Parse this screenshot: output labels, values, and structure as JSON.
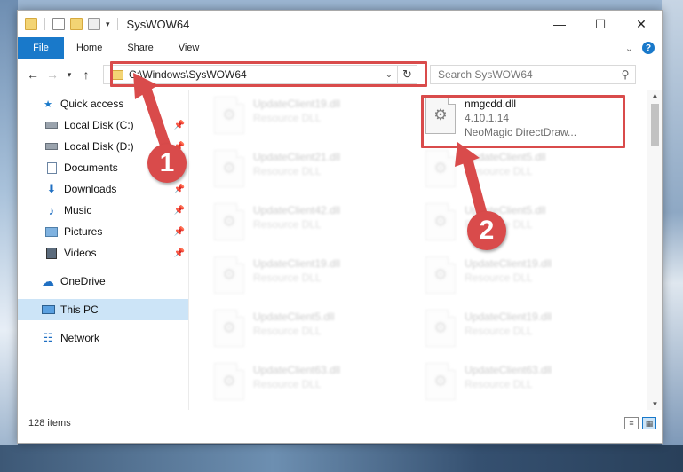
{
  "window": {
    "title": "SysWOW64"
  },
  "ribbon": {
    "tabs": [
      "File",
      "Home",
      "Share",
      "View"
    ]
  },
  "address": {
    "path": "C:\\Windows\\SysWOW64"
  },
  "search": {
    "placeholder": "Search SysWOW64"
  },
  "sidebar": {
    "quick_access": "Quick access",
    "items": [
      {
        "label": "Local Disk (C:)",
        "icon": "drive-icon",
        "pinned": true
      },
      {
        "label": "Local Disk (D:)",
        "icon": "drive-icon",
        "pinned": true
      },
      {
        "label": "Documents",
        "icon": "documents-icon",
        "pinned": true
      },
      {
        "label": "Downloads",
        "icon": "downloads-icon",
        "pinned": true
      },
      {
        "label": "Music",
        "icon": "music-icon",
        "pinned": true
      },
      {
        "label": "Pictures",
        "icon": "pictures-icon",
        "pinned": true
      },
      {
        "label": "Videos",
        "icon": "videos-icon",
        "pinned": true
      }
    ],
    "onedrive": "OneDrive",
    "this_pc": "This PC",
    "network": "Network"
  },
  "files": [
    {
      "name": "UpdateClient19.dll",
      "line1": "Resource DLL",
      "line2": ""
    },
    {
      "name": "nmgcdd.dll",
      "line1": "4.10.1.14",
      "line2": "NeoMagic DirectDraw..."
    },
    {
      "name": "UpdateClient21.dll",
      "line1": "Resource DLL",
      "line2": ""
    },
    {
      "name": "UpdateClient5.dll",
      "line1": "Resource DLL",
      "line2": ""
    },
    {
      "name": "UpdateClient42.dll",
      "line1": "Resource DLL",
      "line2": ""
    },
    {
      "name": "UpdateClient5.dll",
      "line1": "Resource DLL",
      "line2": ""
    },
    {
      "name": "UpdateClient19.dll",
      "line1": "Resource DLL",
      "line2": ""
    },
    {
      "name": "UpdateClient19.dll",
      "line1": "Resource DLL",
      "line2": ""
    },
    {
      "name": "UpdateClient5.dll",
      "line1": "Resource DLL",
      "line2": ""
    },
    {
      "name": "UpdateClient19.dll",
      "line1": "Resource DLL",
      "line2": ""
    },
    {
      "name": "UpdateClient63.dll",
      "line1": "Resource DLL",
      "line2": ""
    },
    {
      "name": "UpdateClient63.dll",
      "line1": "Resource DLL",
      "line2": ""
    }
  ],
  "status": {
    "item_count": "128 items"
  },
  "annotations": {
    "step1": "1",
    "step2": "2"
  },
  "colors": {
    "accent": "#1979ca",
    "highlight": "#d94b4b",
    "selected": "#cce4f7"
  }
}
